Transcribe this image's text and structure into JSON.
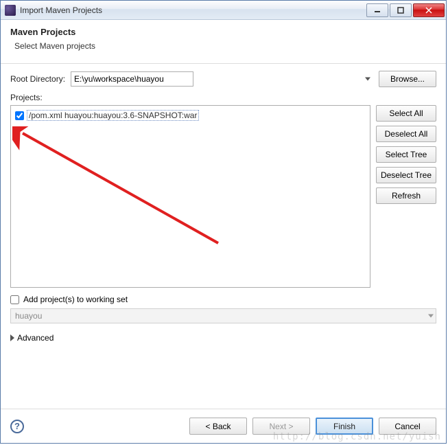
{
  "window": {
    "title": "Import Maven Projects"
  },
  "header": {
    "title": "Maven Projects",
    "subtitle": "Select Maven projects"
  },
  "root": {
    "label": "Root Directory:",
    "value": "E:\\yu\\workspace\\huayou",
    "browse": "Browse..."
  },
  "projects": {
    "label": "Projects:",
    "items": [
      {
        "checked": true,
        "text": "/pom.xml  huayou:huayou:3.6-SNAPSHOT:war"
      }
    ],
    "buttons": {
      "select_all": "Select All",
      "deselect_all": "Deselect All",
      "select_tree": "Select Tree",
      "deselect_tree": "Deselect Tree",
      "refresh": "Refresh"
    }
  },
  "working_set": {
    "checkbox_label": "Add project(s) to working set",
    "combo_value": "huayou"
  },
  "advanced": {
    "label": "Advanced"
  },
  "footer": {
    "back": "< Back",
    "next": "Next >",
    "finish": "Finish",
    "cancel": "Cancel"
  },
  "watermark": "http://blog.csdn.net/yuish"
}
